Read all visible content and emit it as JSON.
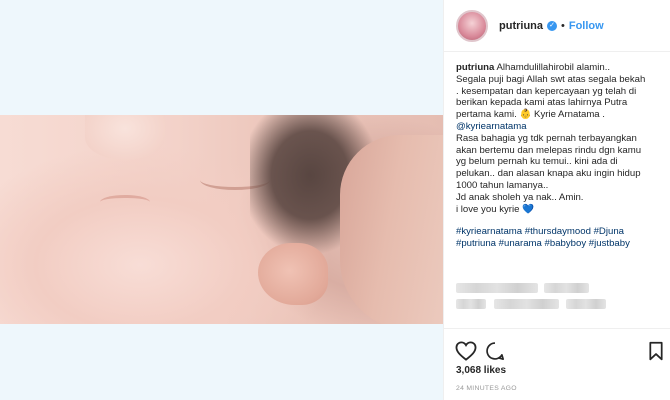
{
  "post": {
    "username": "putriuna",
    "follow_label": "Follow",
    "separator": "•",
    "caption_first_line": "Alhamdulillahirobil alamin..",
    "caption_lines": [
      "Segala puji bagi Allah swt atas segala bekah",
      ". kesempatan dan kepercayaan yg telah di",
      "berikan kepada kami atas lahirnya Putra",
      "pertama kami. 👶 Kyrie Arnatama .",
      "@kyriearnatama",
      "Rasa bahagia yg tdk pernah terbayangkan",
      "akan bertemu dan melepas rindu dgn kamu",
      "yg belum pernah ku temui.. kini ada di",
      "pelukan.. dan alasan knapa aku ingin hidup",
      "1000 tahun lamanya..",
      "Jd anak sholeh ya nak.. Amin.",
      "i love you kyrie 💙"
    ],
    "hashtag_lines": [
      "#kyriearnatama #thursdaymood #Djuna",
      "#putriuna #unarama #babyboy #justbaby"
    ],
    "likes": "3,068 likes",
    "timestamp": "24 MINUTES AGO"
  },
  "icons": {
    "verified": "verified-badge-icon",
    "like": "heart-icon",
    "comment": "comment-icon",
    "save": "bookmark-icon"
  },
  "colors": {
    "link": "#3897f0",
    "hashtag": "#003569",
    "media_bg": "#eef7fc"
  }
}
